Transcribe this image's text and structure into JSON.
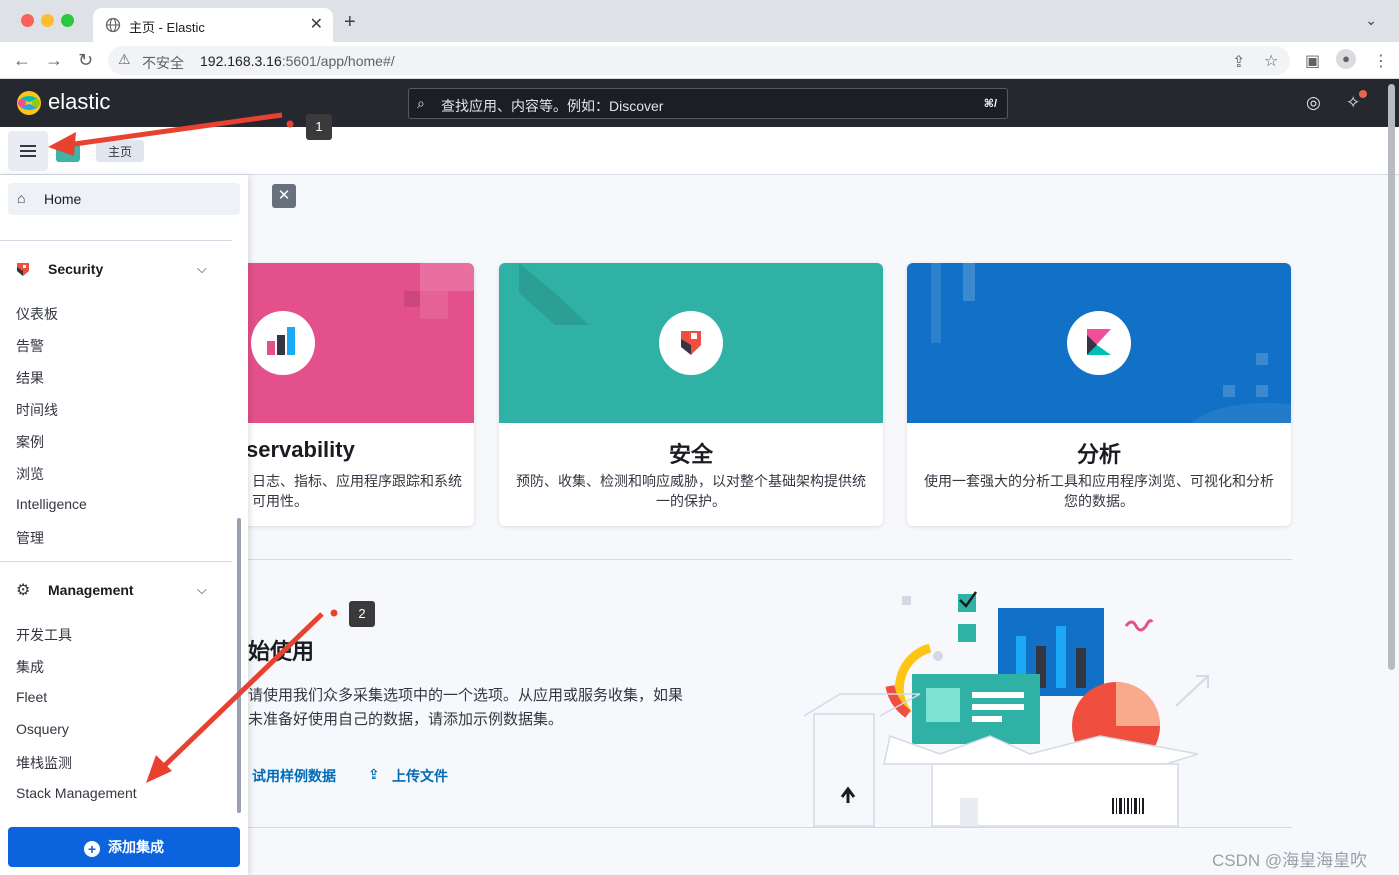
{
  "browser": {
    "tab_title": "主页 - Elastic",
    "insecure_label": "不安全",
    "url_host": "192.168.3.16",
    "url_rest": ":5601/app/home#/"
  },
  "header": {
    "brand": "elastic",
    "search_placeholder": "查找应用、内容等。例如：Discover",
    "shortcut": "⌘/"
  },
  "breadcrumb": {
    "current": "主页"
  },
  "sidenav": {
    "home_label": "Home",
    "security": {
      "label": "Security",
      "items": [
        "仪表板",
        "告警",
        "结果",
        "时间线",
        "案例",
        "浏览",
        "Intelligence",
        "管理"
      ]
    },
    "management": {
      "label": "Management",
      "items": [
        "开发工具",
        "集成",
        "Fleet",
        "Osquery",
        "堆栈监测",
        "Stack Management"
      ]
    },
    "add_integration": "添加集成"
  },
  "solutions": [
    {
      "title": "servability",
      "desc": "日志、指标、应用程序跟踪和系统可用性。",
      "color": "#e4508b"
    },
    {
      "title": "安全",
      "desc": "预防、收集、检测和响应威胁，以对整个基础架构提供统一的保护。",
      "color": "#30b1a5"
    },
    {
      "title": "分析",
      "desc": "使用一套强大的分析工具和应用程序浏览、可视化和分析您的数据。",
      "color": "#1171c6"
    }
  ],
  "getting_started": {
    "title": "始使用",
    "desc": "请使用我们众多采集选项中的一个选项。从应用或服务收集，如果未准备好使用自己的数据，请添加示例数据集。",
    "try_sample": "试用样例数据",
    "upload_file": "上传文件"
  },
  "annotations": {
    "badge1": "1",
    "badge2": "2"
  },
  "watermark": "CSDN @海皇海皇吹"
}
